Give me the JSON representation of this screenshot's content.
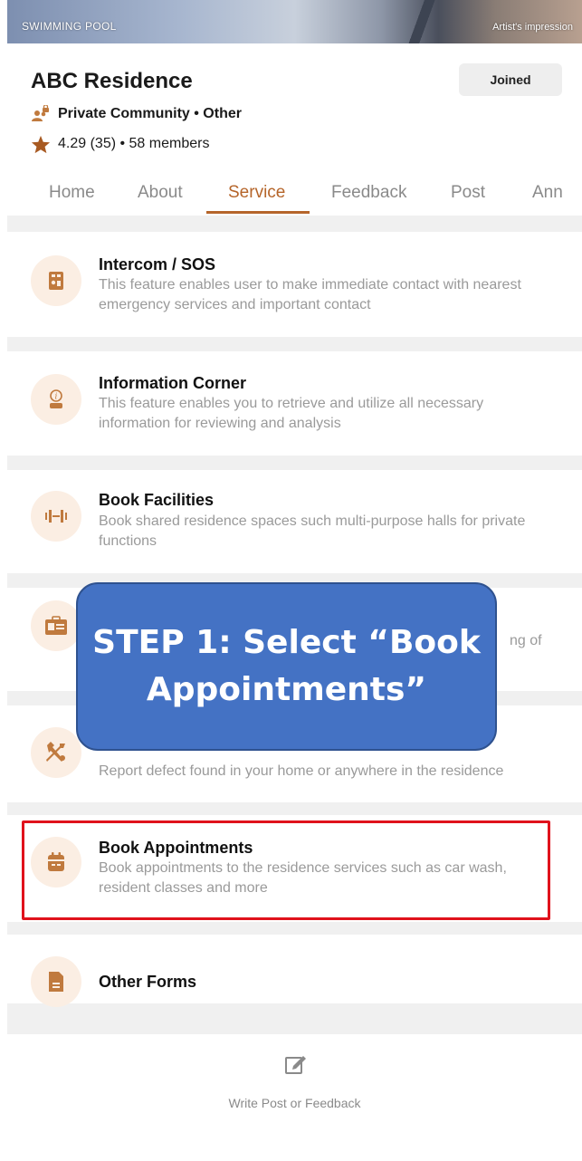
{
  "banner": {
    "location_label": "SWIMMING POOL",
    "note": "Artist's impression"
  },
  "community": {
    "name": "ABC Residence",
    "join_label": "Joined",
    "type": "Private Community • Other",
    "rating_summary": "4.29 (35) • 58 members"
  },
  "tabs": [
    {
      "label": "Home"
    },
    {
      "label": "About"
    },
    {
      "label": "Service"
    },
    {
      "label": "Feedback"
    },
    {
      "label": "Post"
    },
    {
      "label": "Ann"
    }
  ],
  "active_tab": "Service",
  "services": [
    {
      "title": "Intercom / SOS",
      "description": "This feature enables user to make immediate contact with nearest emergency services and important contact",
      "icon": "intercom-icon"
    },
    {
      "title": "Information Corner",
      "description": "This feature enables you to retrieve and utilize all necessary information for reviewing and analysis",
      "icon": "info-icon"
    },
    {
      "title": "Book Facilities",
      "description": "Book shared residence spaces such multi-purpose halls for private functions",
      "icon": "facilities-icon"
    },
    {
      "title": "",
      "description": "ng of",
      "icon": "id-card-icon"
    },
    {
      "title": "",
      "description": "Report defect found in your home or anywhere in the residence",
      "icon": "tools-icon"
    },
    {
      "title": "Book Appointments",
      "description": "Book appointments to the residence services such as car wash, resident classes and more",
      "icon": "calendar-icon"
    },
    {
      "title": "Other Forms",
      "description": "",
      "icon": "document-icon"
    }
  ],
  "callout": {
    "text": "STEP 1: Select “Book Appointments”"
  },
  "footer": {
    "write_label": "Write Post or Feedback"
  },
  "colors": {
    "accent": "#b5652a",
    "icon_bg": "#fbeee3",
    "highlight": "#e0121c",
    "callout_bg": "#4472c4"
  }
}
